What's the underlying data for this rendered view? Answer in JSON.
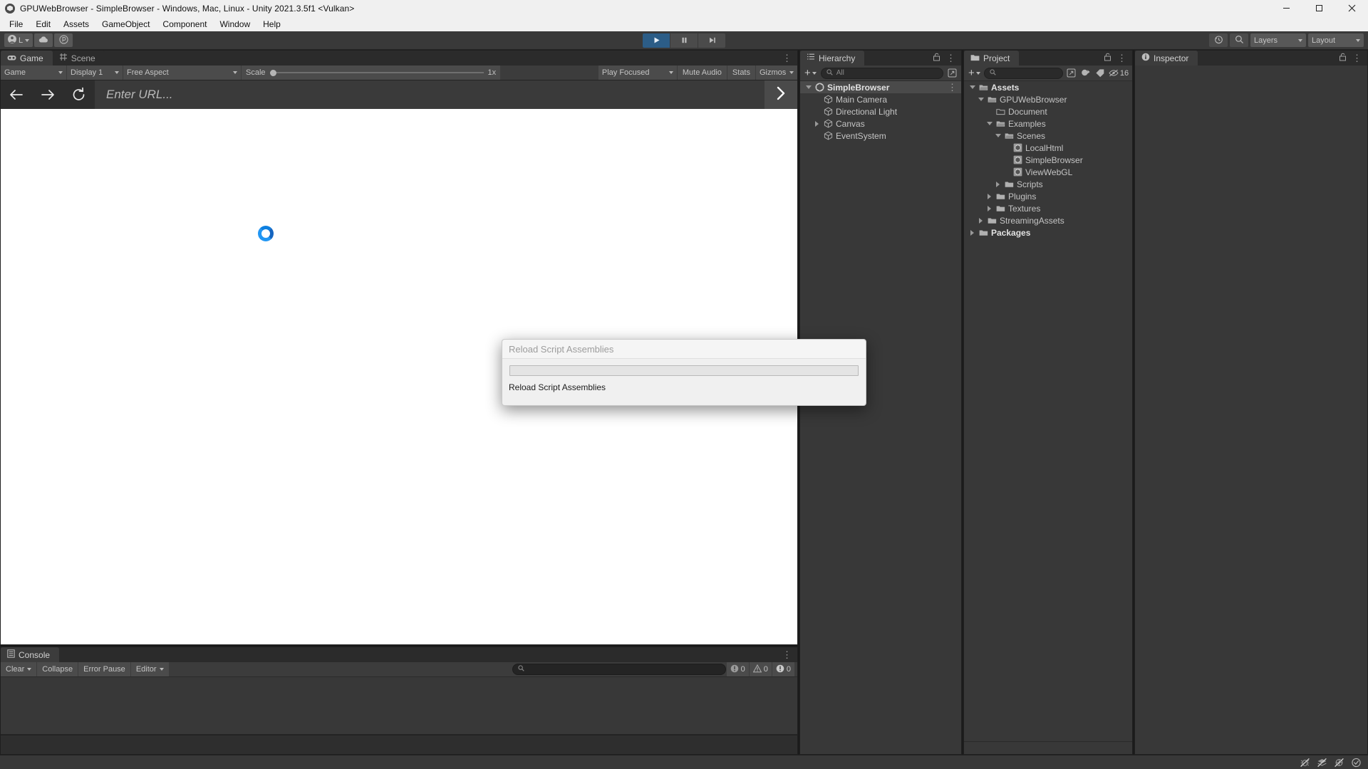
{
  "window": {
    "title": "GPUWebBrowser - SimpleBrowser - Windows, Mac, Linux - Unity 2021.3.5f1 <Vulkan>",
    "app_icon": "unity-logo-icon",
    "minimize": "minimize-icon",
    "maximize": "maximize-icon",
    "close": "close-icon"
  },
  "menubar": {
    "items": [
      "File",
      "Edit",
      "Assets",
      "GameObject",
      "Component",
      "Window",
      "Help"
    ]
  },
  "toolbar": {
    "account_label": "L",
    "account_icon": "account-icon",
    "cloud_icon": "cloud-icon",
    "services_icon": "unity-services-icon",
    "play_icon": "play-icon",
    "pause_icon": "pause-icon",
    "step_icon": "step-icon",
    "play_active": true,
    "undo_history_icon": "undo-history-icon",
    "search_icon": "search-icon",
    "layers_label": "Layers",
    "layout_label": "Layout"
  },
  "gameview": {
    "tabs": [
      {
        "label": "Game",
        "icon": "game-icon",
        "active": true
      },
      {
        "label": "Scene",
        "icon": "scene-grid-icon",
        "active": false
      }
    ],
    "toolbar": {
      "target_display_mode": "Game",
      "display": "Display 1",
      "aspect": "Free Aspect",
      "scale_label": "Scale",
      "scale_value": "1x",
      "play_mode_focus": "Play Focused",
      "mute_audio": "Mute Audio",
      "stats": "Stats",
      "gizmos": "Gizmos"
    },
    "browser": {
      "back_icon": "arrow-left-icon",
      "forward_icon": "arrow-right-icon",
      "reload_icon": "reload-icon",
      "url_placeholder": "Enter URL...",
      "url_value": "",
      "go_icon": "chevron-right-icon",
      "loading_spinner": "loading-spinner-icon",
      "spinner_color": "#2196f3"
    }
  },
  "console": {
    "tab_label": "Console",
    "tab_icon": "console-icon",
    "clear_label": "Clear",
    "collapse_label": "Collapse",
    "error_pause_label": "Error Pause",
    "editor_label": "Editor",
    "search_placeholder": "",
    "search_icon": "search-icon",
    "counts": {
      "log": "0",
      "warning": "0",
      "error": "0"
    },
    "log_icon": "log-icon",
    "warning_icon": "warning-icon",
    "error_icon": "error-icon"
  },
  "hierarchy": {
    "tab_label": "Hierarchy",
    "tab_icon": "hierarchy-icon",
    "lock_icon": "lock-icon",
    "menu_icon": "kebab-icon",
    "add_icon": "plus-icon",
    "search_placeholder": "All",
    "search_icon": "search-icon",
    "expand_icon": "expand-window-icon",
    "items": [
      {
        "label": "SimpleBrowser",
        "depth": 0,
        "twisty": "down",
        "icon": "unity-scene-icon",
        "selected": true,
        "bold": true
      },
      {
        "label": "Main Camera",
        "depth": 1,
        "twisty": "none",
        "icon": "gameobject-icon",
        "selected": false,
        "bold": false
      },
      {
        "label": "Directional Light",
        "depth": 1,
        "twisty": "none",
        "icon": "gameobject-icon",
        "selected": false,
        "bold": false
      },
      {
        "label": "Canvas",
        "depth": 1,
        "twisty": "right",
        "icon": "gameobject-icon",
        "selected": false,
        "bold": false
      },
      {
        "label": "EventSystem",
        "depth": 1,
        "twisty": "none",
        "icon": "gameobject-icon",
        "selected": false,
        "bold": false
      }
    ]
  },
  "project": {
    "tab_label": "Project",
    "tab_icon": "folder-icon",
    "lock_icon": "lock-icon",
    "menu_icon": "kebab-icon",
    "add_icon": "plus-icon",
    "search_placeholder": "",
    "search_icon": "search-icon",
    "expand_icon": "expand-window-icon",
    "filter_type_icon": "filter-type-icon",
    "filter_label_icon": "filter-label-icon",
    "visibility_icon": "hidden-eye-icon",
    "visibility_count": "16",
    "items": [
      {
        "label": "Assets",
        "depth": 0,
        "twisty": "down",
        "icon": "folder-open-icon",
        "bold": true
      },
      {
        "label": "GPUWebBrowser",
        "depth": 1,
        "twisty": "down",
        "icon": "folder-open-icon",
        "bold": false
      },
      {
        "label": "Document",
        "depth": 2,
        "twisty": "none",
        "icon": "folder-empty-icon",
        "bold": false
      },
      {
        "label": "Examples",
        "depth": 2,
        "twisty": "down",
        "icon": "folder-open-icon",
        "bold": false
      },
      {
        "label": "Scenes",
        "depth": 3,
        "twisty": "down",
        "icon": "folder-open-icon",
        "bold": false
      },
      {
        "label": "LocalHtml",
        "depth": 4,
        "twisty": "none",
        "icon": "unity-scene-asset-icon",
        "bold": false
      },
      {
        "label": "SimpleBrowser",
        "depth": 4,
        "twisty": "none",
        "icon": "unity-scene-asset-icon",
        "bold": false
      },
      {
        "label": "ViewWebGL",
        "depth": 4,
        "twisty": "none",
        "icon": "unity-scene-asset-icon",
        "bold": false
      },
      {
        "label": "Scripts",
        "depth": 3,
        "twisty": "right",
        "icon": "folder-icon",
        "bold": false
      },
      {
        "label": "Plugins",
        "depth": 2,
        "twisty": "right",
        "icon": "folder-icon",
        "bold": false
      },
      {
        "label": "Textures",
        "depth": 2,
        "twisty": "right",
        "icon": "folder-icon",
        "bold": false
      },
      {
        "label": "StreamingAssets",
        "depth": 1,
        "twisty": "right",
        "icon": "folder-icon",
        "bold": false
      },
      {
        "label": "Packages",
        "depth": 0,
        "twisty": "right",
        "icon": "folder-icon",
        "bold": true
      }
    ]
  },
  "inspector": {
    "tab_label": "Inspector",
    "tab_icon": "info-icon",
    "lock_icon": "lock-icon",
    "menu_icon": "kebab-icon"
  },
  "quick_search": {
    "title": "Reload Script Assemblies",
    "input_value": "",
    "result_label": "Reload Script Assemblies"
  },
  "statusbar": {
    "icons": [
      "bug-off-icon",
      "layers-off-icon",
      "preview-off-icon",
      "check-circle-icon"
    ]
  },
  "colors": {
    "accent_blue": "#2c5d87",
    "panel_bg": "#383838",
    "toolbar_bg": "#3c3c3c",
    "tab_bg": "#2b2b2b",
    "title_bg": "#f0f0f0"
  }
}
